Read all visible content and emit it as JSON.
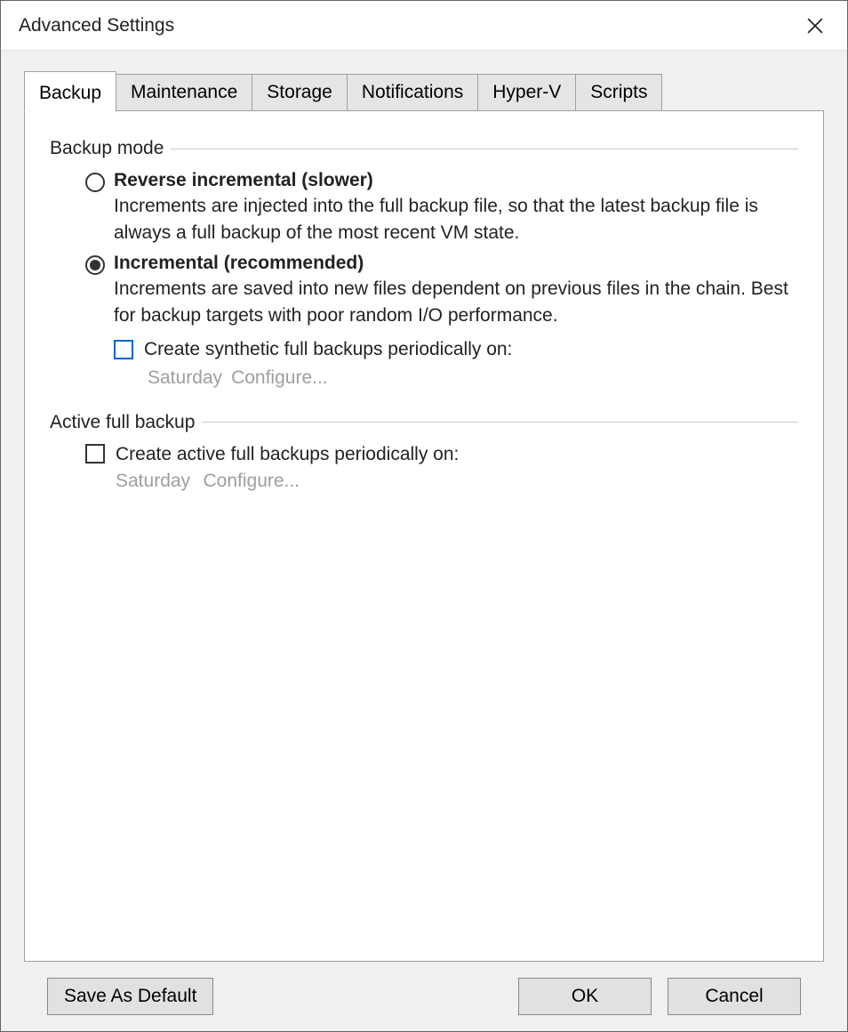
{
  "titlebar": {
    "title": "Advanced Settings"
  },
  "tabs": [
    {
      "label": "Backup",
      "active": true
    },
    {
      "label": "Maintenance"
    },
    {
      "label": "Storage"
    },
    {
      "label": "Notifications"
    },
    {
      "label": "Hyper-V"
    },
    {
      "label": "Scripts"
    }
  ],
  "backup_mode": {
    "legend": "Backup mode",
    "reverse": {
      "title": "Reverse incremental (slower)",
      "desc": "Increments are injected into the full backup file, so that the latest backup file is always a full backup of the most recent VM state.",
      "selected": false
    },
    "incremental": {
      "title": "Incremental (recommended)",
      "desc": "Increments are saved into new files dependent on previous files in the chain. Best for backup targets with poor random I/O performance.",
      "selected": true,
      "synthetic": {
        "label": "Create synthetic full backups periodically on:",
        "checked": false,
        "day": "Saturday",
        "configure": "Configure..."
      }
    }
  },
  "active_full": {
    "legend": "Active full backup",
    "create": {
      "label": "Create active full backups periodically on:",
      "checked": false,
      "day": "Saturday",
      "configure": "Configure..."
    }
  },
  "footer": {
    "save_default": "Save As Default",
    "ok": "OK",
    "cancel": "Cancel"
  }
}
